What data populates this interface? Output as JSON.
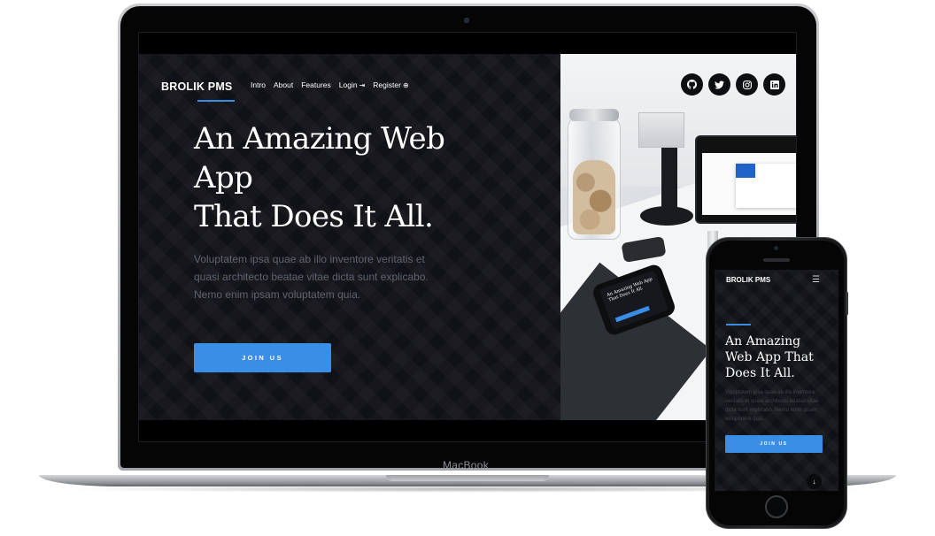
{
  "device_labels": {
    "laptop": "MacBook"
  },
  "desktop": {
    "brand": "BROLIK PMS",
    "nav": [
      {
        "label": "Intro",
        "active": true,
        "icon": ""
      },
      {
        "label": "About",
        "active": false,
        "icon": ""
      },
      {
        "label": "Features",
        "active": false,
        "icon": ""
      },
      {
        "label": "Login",
        "active": false,
        "icon": "sign-in-icon"
      },
      {
        "label": "Register",
        "active": false,
        "icon": "plus-circle-icon"
      }
    ],
    "hero_title_lines": [
      "An Amazing Web",
      "App",
      "That Does It All."
    ],
    "hero_text_lines": [
      "Voluptatem ipsa quae ab illo inventore veritatis et",
      "quasi architecto beatae vitae dicta sunt explicabo.",
      "Nemo enim ipsam voluptatem quia."
    ],
    "join_label": "JOIN US",
    "socials": [
      {
        "icon": "github-icon",
        "glyph": "●"
      },
      {
        "icon": "twitter-icon",
        "glyph": "t"
      },
      {
        "icon": "instagram-icon",
        "glyph": "◎"
      },
      {
        "icon": "linkedin-icon",
        "glyph": "in"
      }
    ],
    "photo_phone_title": "An Amazing Web App That Does It All."
  },
  "mobile": {
    "brand": "BROLIK PMS",
    "menu_icon": "hamburger-menu-icon",
    "hero_title_lines": [
      "An Amazing",
      "Web App That",
      "Does It All."
    ],
    "hero_text_lines": [
      "Voluptatem ipsa quae ab illo inventore",
      "veritatis et quasi architecto beatae vitae",
      "dicta sunt explicabo. Nemo enim ipsam",
      "voluptatem quia."
    ],
    "join_label": "JOIN US"
  },
  "colors": {
    "accent": "#3a8ee6",
    "dark_bg": "#111217",
    "muted_text": "#5e6470"
  }
}
